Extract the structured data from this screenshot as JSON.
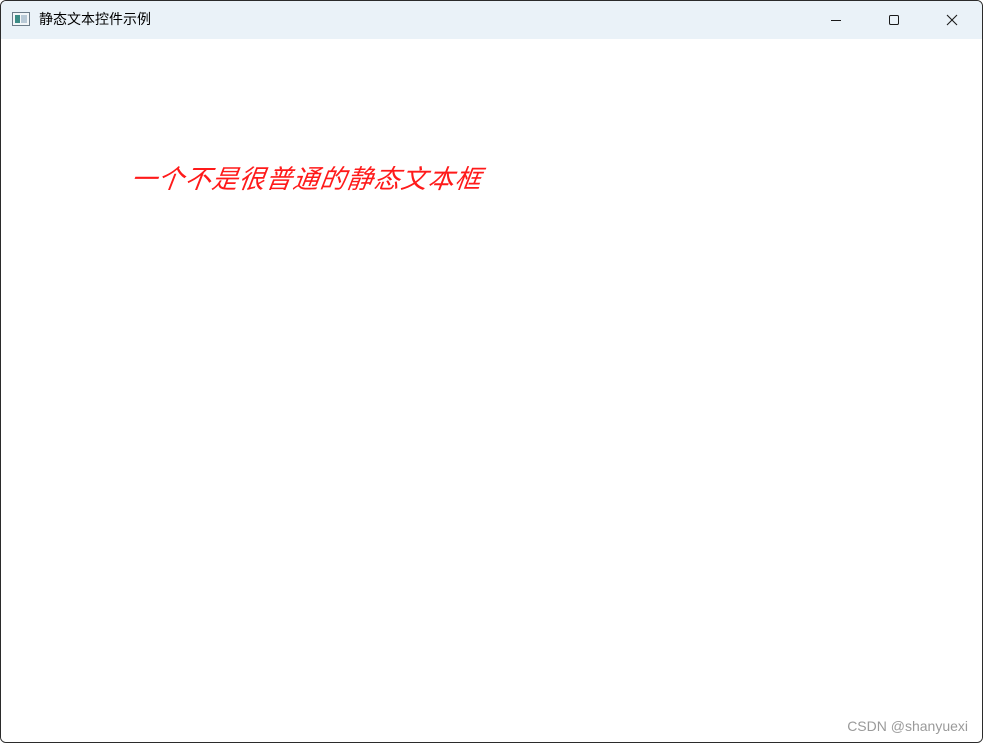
{
  "window": {
    "title": "静态文本控件示例",
    "icon": "app-window-icon"
  },
  "caption_buttons": {
    "minimize_icon": "minimize-icon",
    "maximize_icon": "maximize-icon",
    "close_icon": "close-icon"
  },
  "content": {
    "static_text": "一个不是很普通的静态文本框",
    "static_text_color": "#ff1a1a"
  },
  "watermark": {
    "text": "CSDN @shanyuexi"
  }
}
